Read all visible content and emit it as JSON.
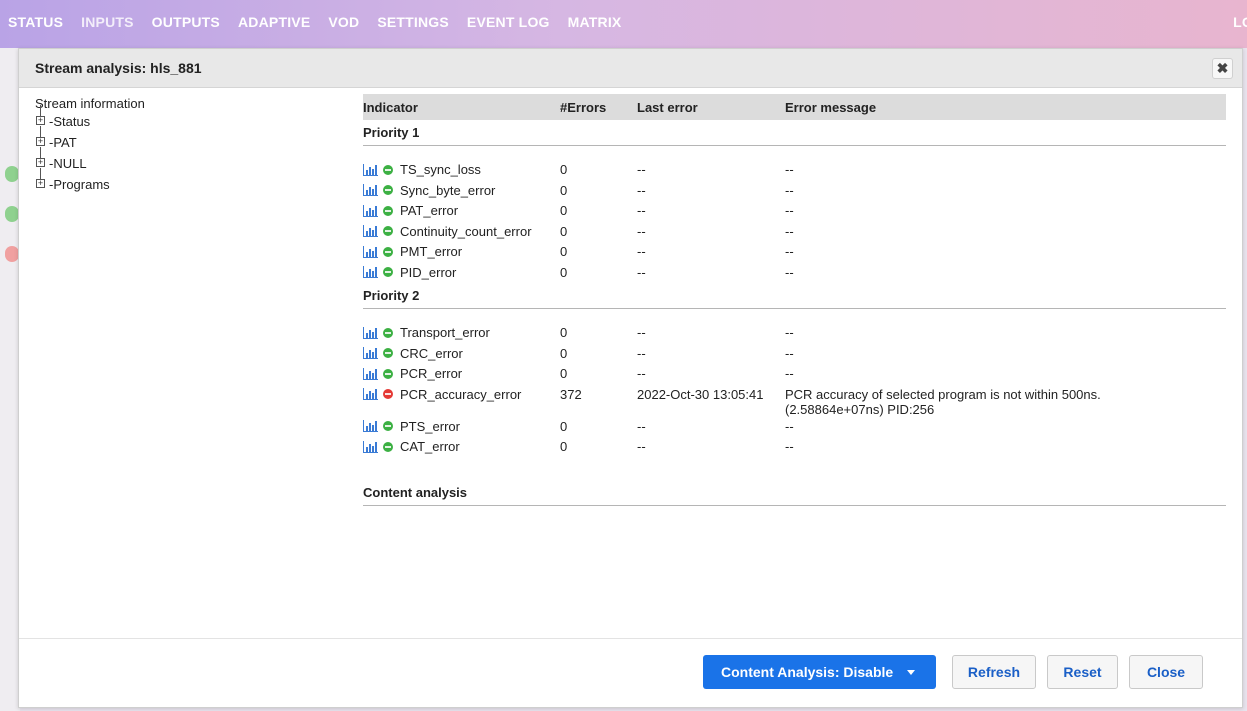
{
  "nav": {
    "items": [
      "STATUS",
      "INPUTS",
      "OUTPUTS",
      "ADAPTIVE",
      "VOD",
      "SETTINGS",
      "EVENT LOG",
      "MATRIX"
    ],
    "logout_label": "LO"
  },
  "dialog": {
    "title": "Stream analysis: hls_881",
    "close_icon": "close-icon"
  },
  "tree": {
    "heading": "Stream information",
    "nodes": [
      "-Status",
      "-PAT",
      "-NULL",
      "-Programs"
    ]
  },
  "table": {
    "headers": {
      "indicator": "Indicator",
      "errors": "#Errors",
      "last_error": "Last error",
      "message": "Error message"
    },
    "priority1": {
      "label": "Priority 1",
      "rows": [
        {
          "name": "TS_sync_loss",
          "status": "ok",
          "count": "0",
          "last": "--",
          "message": "--"
        },
        {
          "name": "Sync_byte_error",
          "status": "ok",
          "count": "0",
          "last": "--",
          "message": "--"
        },
        {
          "name": "PAT_error",
          "status": "ok",
          "count": "0",
          "last": "--",
          "message": "--"
        },
        {
          "name": "Continuity_count_error",
          "status": "ok",
          "count": "0",
          "last": "--",
          "message": "--"
        },
        {
          "name": "PMT_error",
          "status": "ok",
          "count": "0",
          "last": "--",
          "message": "--"
        },
        {
          "name": "PID_error",
          "status": "ok",
          "count": "0",
          "last": "--",
          "message": "--"
        }
      ]
    },
    "priority2": {
      "label": "Priority 2",
      "rows": [
        {
          "name": "Transport_error",
          "status": "ok",
          "count": "0",
          "last": "--",
          "message": "--"
        },
        {
          "name": "CRC_error",
          "status": "ok",
          "count": "0",
          "last": "--",
          "message": "--"
        },
        {
          "name": "PCR_error",
          "status": "ok",
          "count": "0",
          "last": "--",
          "message": "--"
        },
        {
          "name": "PCR_accuracy_error",
          "status": "error",
          "count": "372",
          "last": "2022-Oct-30 13:05:41",
          "message": "PCR accuracy of selected program is not within 500ns.",
          "message2": "(2.58864e+07ns) PID:256"
        },
        {
          "name": "PTS_error",
          "status": "ok",
          "count": "0",
          "last": "--",
          "message": "--"
        },
        {
          "name": "CAT_error",
          "status": "ok",
          "count": "0",
          "last": "--",
          "message": "--"
        }
      ]
    },
    "content_analysis_label": "Content analysis"
  },
  "footer": {
    "content_analysis_button": "Content Analysis: Disable",
    "refresh_button": "Refresh",
    "reset_button": "Reset",
    "close_button": "Close"
  },
  "colors": {
    "status_ok": "#3cb043",
    "status_error": "#e53935",
    "accent": "#1a73e8",
    "chart_icon": "#3a7bd5"
  }
}
